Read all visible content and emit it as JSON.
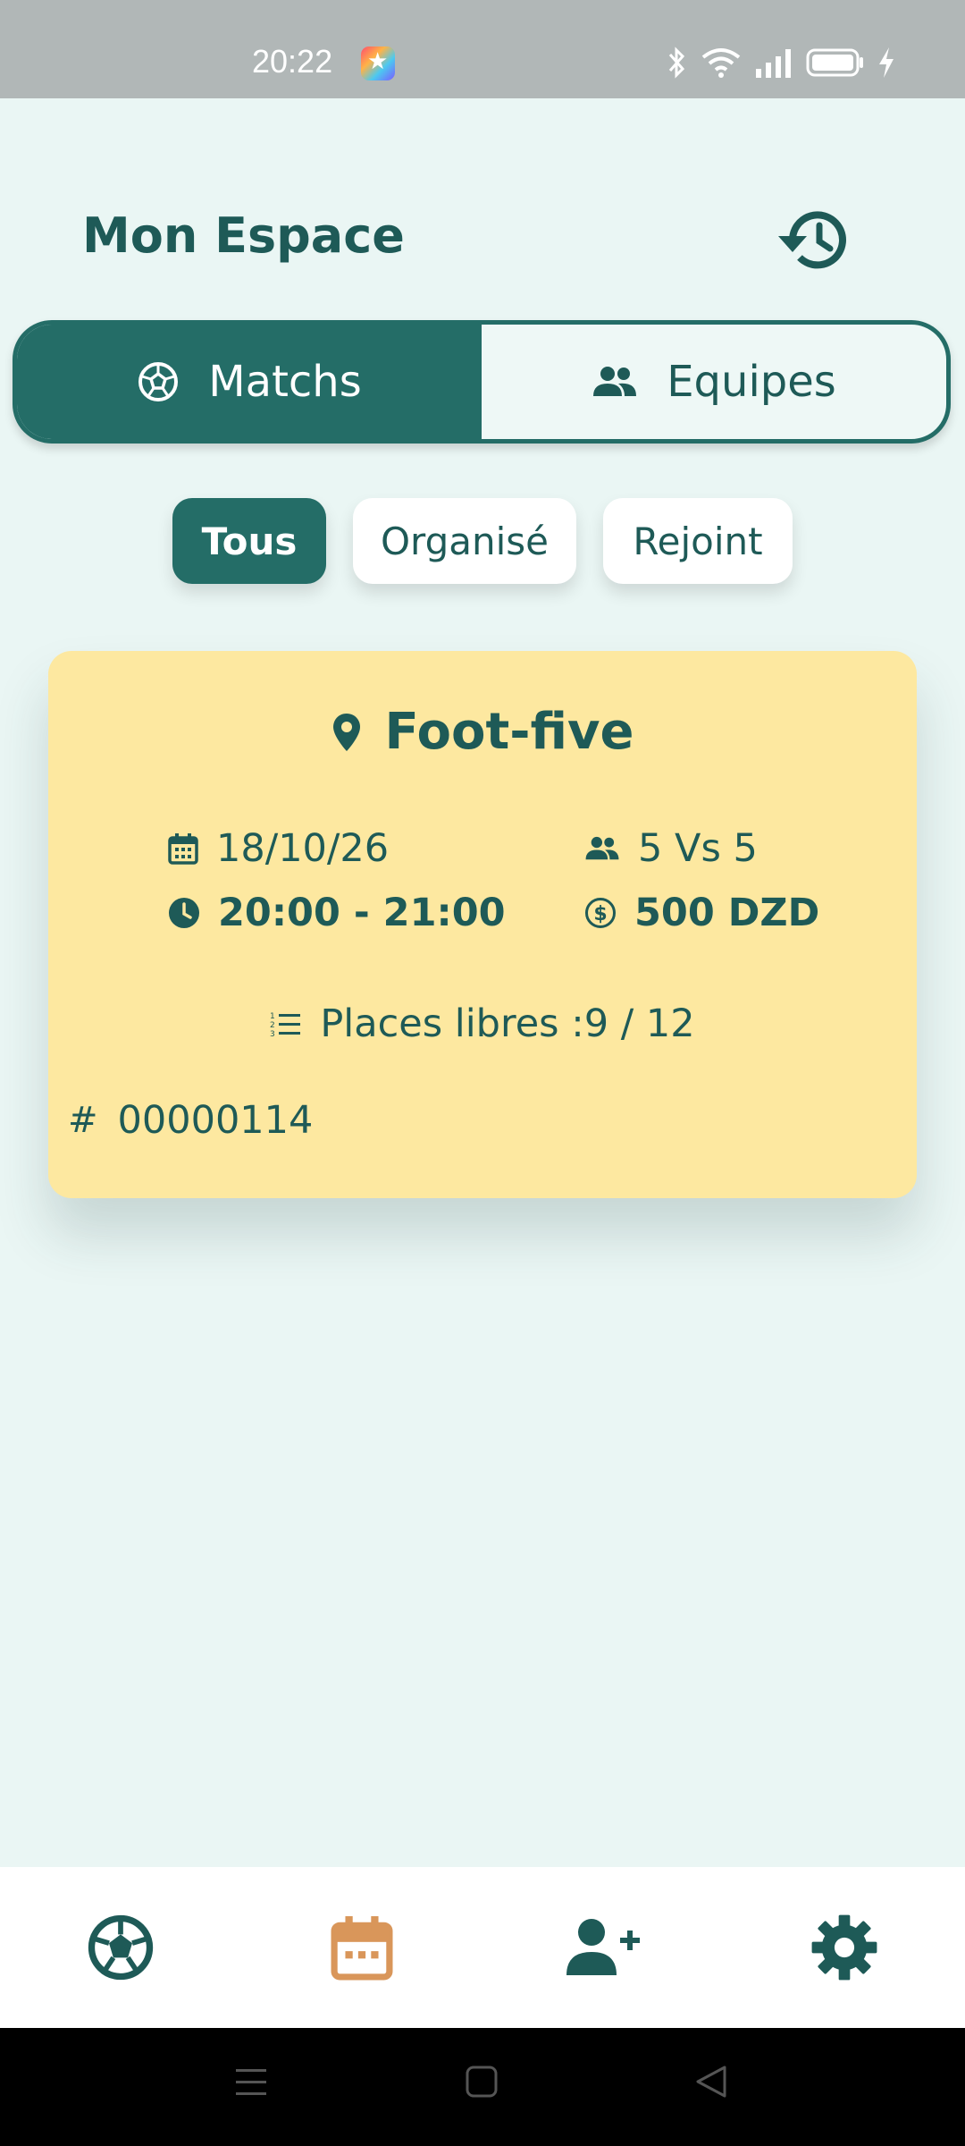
{
  "status_bar": {
    "time": "20:22",
    "icons": [
      "app-star-icon",
      "bluetooth-icon",
      "wifi-icon",
      "signal-icon",
      "battery-icon",
      "charging-icon"
    ]
  },
  "header": {
    "title": "Mon Espace",
    "history_icon": "history-icon"
  },
  "tabs": [
    {
      "label": "Matchs",
      "icon": "soccer-ball-icon",
      "active": true
    },
    {
      "label": "Equipes",
      "icon": "people-icon",
      "active": false
    }
  ],
  "filters": [
    {
      "label": "Tous",
      "active": true
    },
    {
      "label": "Organisé",
      "active": false
    },
    {
      "label": "Rejoint",
      "active": false
    }
  ],
  "match_card": {
    "location": "Foot-five",
    "date": "18/10/26",
    "time": "20:00 - 21:00",
    "format": "5 Vs 5",
    "price": "500 DZD",
    "places": "Places libres :9 / 12",
    "id": "00000114",
    "id_symbol": "#",
    "background": "#fde8a0"
  },
  "bottom_nav": [
    {
      "icon": "soccer-ball-icon",
      "active": false
    },
    {
      "icon": "calendar-icon",
      "active": true
    },
    {
      "icon": "add-user-icon",
      "active": false
    },
    {
      "icon": "gear-icon",
      "active": false
    }
  ],
  "colors": {
    "primary": "#246d67",
    "text": "#1e5a57",
    "background": "#eaf6f4",
    "accent": "#d9965a",
    "card": "#fde8a0"
  }
}
